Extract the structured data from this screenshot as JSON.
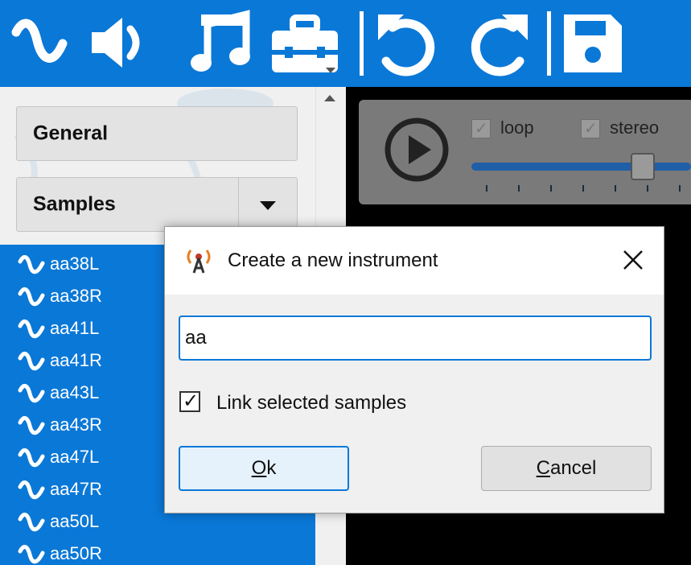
{
  "colors": {
    "accent": "#0a78d7",
    "panel": "#f0f0f0",
    "dark": "#000000",
    "player": "#7a7a7a"
  },
  "toolbar": {
    "icons": [
      "sine-wave-icon",
      "speaker-icon",
      "music-note-icon",
      "toolbox-icon",
      "undo-icon",
      "redo-icon",
      "save-icon"
    ]
  },
  "sidebar": {
    "general_label": "General",
    "samples_label": "Samples",
    "samples": [
      "aa38L",
      "aa38R",
      "aa41L",
      "aa41R",
      "aa43L",
      "aa43R",
      "aa47L",
      "aa47R",
      "aa50L",
      "aa50R"
    ]
  },
  "player": {
    "loop_label": "loop",
    "stereo_label": "stereo",
    "loop_checked": true,
    "stereo_checked": true
  },
  "dialog": {
    "title": "Create a new instrument",
    "input_value": "aa",
    "link_label": "Link selected samples",
    "link_checked": true,
    "ok_label": "Ok",
    "cancel_label": "Cancel"
  }
}
